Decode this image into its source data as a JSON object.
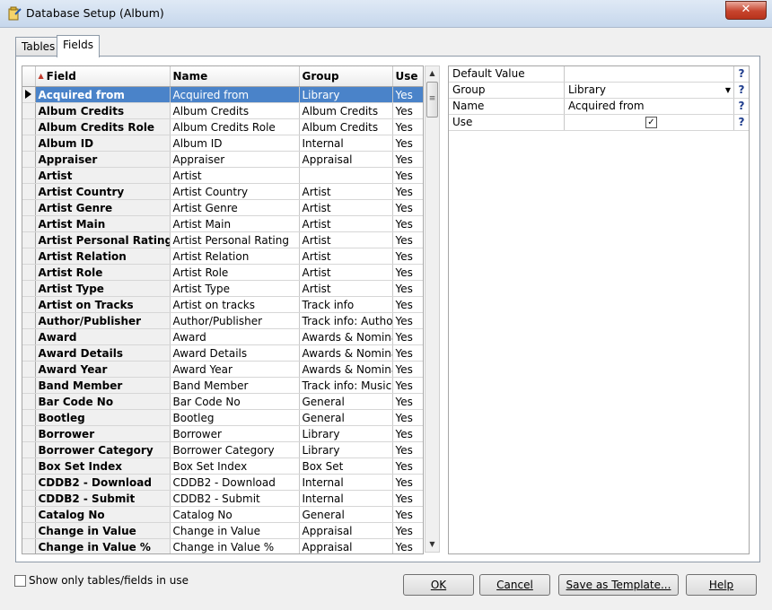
{
  "window": {
    "title": "Database Setup (Album)",
    "close_label": "✕"
  },
  "tabs": [
    {
      "label": "Tables",
      "active": false
    },
    {
      "label": "Fields",
      "active": true
    }
  ],
  "grid": {
    "columns": [
      "Field",
      "Name",
      "Group",
      "Use"
    ],
    "rows": [
      {
        "field": "Acquired from",
        "name": "Acquired from",
        "group": "Library",
        "use": "Yes",
        "selected": true
      },
      {
        "field": "Album Credits",
        "name": "Album Credits",
        "group": "Album Credits",
        "use": "Yes"
      },
      {
        "field": "Album Credits Role",
        "name": "Album Credits Role",
        "group": "Album Credits",
        "use": "Yes"
      },
      {
        "field": "Album ID",
        "name": "Album ID",
        "group": "Internal",
        "use": "Yes"
      },
      {
        "field": "Appraiser",
        "name": "Appraiser",
        "group": "Appraisal",
        "use": "Yes"
      },
      {
        "field": "Artist",
        "name": "Artist",
        "group": "",
        "use": "Yes"
      },
      {
        "field": "Artist Country",
        "name": "Artist Country",
        "group": "Artist",
        "use": "Yes"
      },
      {
        "field": "Artist Genre",
        "name": "Artist Genre",
        "group": "Artist",
        "use": "Yes"
      },
      {
        "field": "Artist Main",
        "name": "Artist Main",
        "group": "Artist",
        "use": "Yes"
      },
      {
        "field": "Artist Personal Rating",
        "name": "Artist Personal Rating",
        "group": "Artist",
        "use": "Yes"
      },
      {
        "field": "Artist Relation",
        "name": "Artist Relation",
        "group": "Artist",
        "use": "Yes"
      },
      {
        "field": "Artist Role",
        "name": "Artist Role",
        "group": "Artist",
        "use": "Yes"
      },
      {
        "field": "Artist Type",
        "name": "Artist Type",
        "group": "Artist",
        "use": "Yes"
      },
      {
        "field": "Artist on Tracks",
        "name": "Artist on tracks",
        "group": "Track info",
        "use": "Yes"
      },
      {
        "field": "Author/Publisher",
        "name": "Author/Publisher",
        "group": "Track info: Author/",
        "use": "Yes"
      },
      {
        "field": "Award",
        "name": "Award",
        "group": "Awards & Nominat",
        "use": "Yes"
      },
      {
        "field": "Award Details",
        "name": "Award Details",
        "group": "Awards & Nominat",
        "use": "Yes"
      },
      {
        "field": "Award Year",
        "name": "Award Year",
        "group": "Awards & Nominat",
        "use": "Yes"
      },
      {
        "field": "Band Member",
        "name": "Band Member",
        "group": "Track info: Musicia",
        "use": "Yes"
      },
      {
        "field": "Bar Code No",
        "name": "Bar Code No",
        "group": "General",
        "use": "Yes"
      },
      {
        "field": "Bootleg",
        "name": "Bootleg",
        "group": "General",
        "use": "Yes"
      },
      {
        "field": "Borrower",
        "name": "Borrower",
        "group": "Library",
        "use": "Yes"
      },
      {
        "field": "Borrower Category",
        "name": "Borrower Category",
        "group": "Library",
        "use": "Yes"
      },
      {
        "field": "Box Set Index",
        "name": "Box Set Index",
        "group": "Box Set",
        "use": "Yes"
      },
      {
        "field": "CDDB2 - Download",
        "name": "CDDB2 - Download",
        "group": "Internal",
        "use": "Yes"
      },
      {
        "field": "CDDB2 - Submit",
        "name": "CDDB2 - Submit",
        "group": "Internal",
        "use": "Yes"
      },
      {
        "field": "Catalog No",
        "name": "Catalog No",
        "group": "General",
        "use": "Yes"
      },
      {
        "field": "Change in Value",
        "name": "Change in Value",
        "group": "Appraisal",
        "use": "Yes"
      },
      {
        "field": "Change in Value %",
        "name": "Change in Value %",
        "group": "Appraisal",
        "use": "Yes"
      }
    ]
  },
  "properties": [
    {
      "name": "Default Value",
      "value": "",
      "kind": "text"
    },
    {
      "name": "Group",
      "value": "Library",
      "kind": "dropdown"
    },
    {
      "name": "Name",
      "value": "Acquired from",
      "kind": "text"
    },
    {
      "name": "Use",
      "value": "✓",
      "kind": "checkbox"
    }
  ],
  "help_glyph": "?",
  "footer": {
    "show_only_label": "Show only tables/fields in use",
    "ok_label": "OK",
    "cancel_label": "Cancel",
    "save_template_label": "Save as Template...",
    "help_label": "Help"
  }
}
